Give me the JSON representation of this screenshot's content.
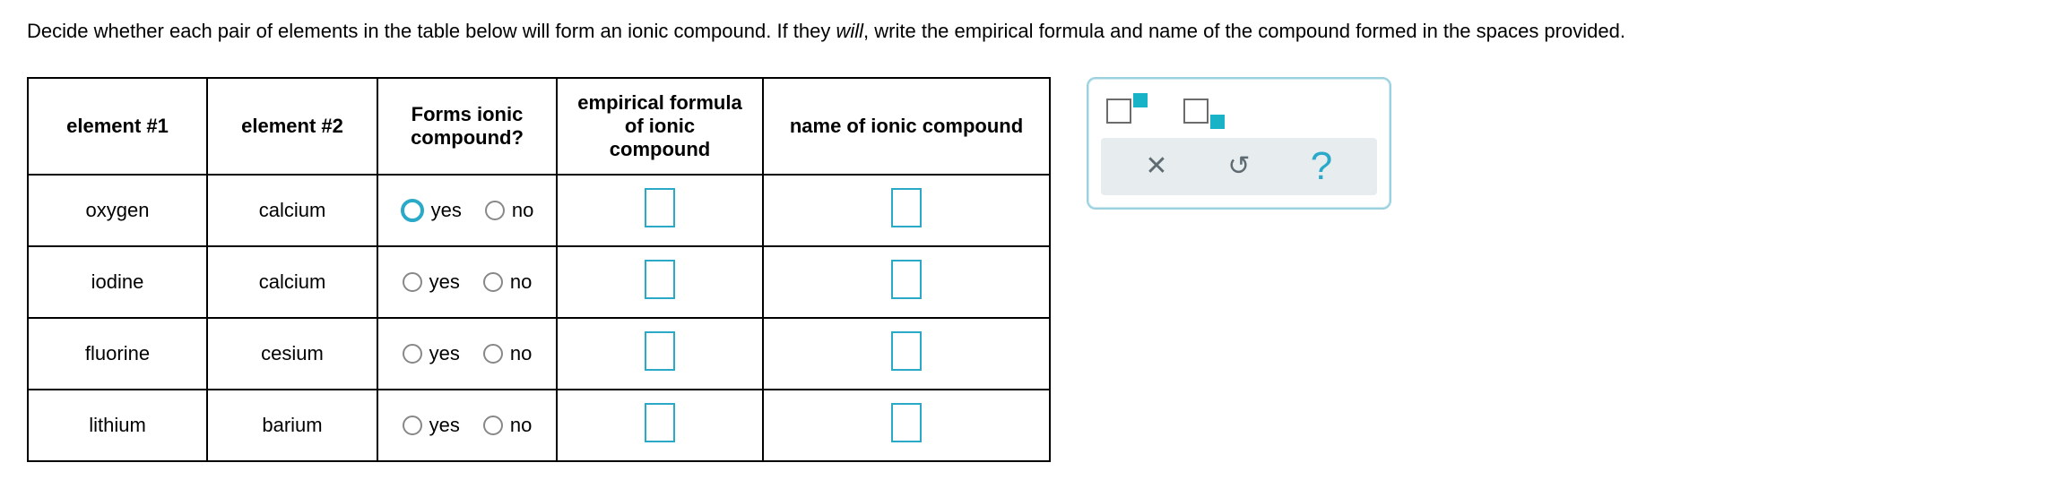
{
  "instructions": {
    "pre": "Decide whether each pair of elements in the table below will form an ionic compound. If they ",
    "em": "will",
    "post": ", write the empirical formula and name of the compound formed in the spaces provided."
  },
  "headers": {
    "element1": "element #1",
    "element2": "element #2",
    "forms": "Forms ionic compound?",
    "formula": "empirical formula of ionic compound",
    "name": "name of ionic compound"
  },
  "radio_labels": {
    "yes": "yes",
    "no": "no"
  },
  "rows": [
    {
      "e1": "oxygen",
      "e2": "calcium",
      "yes_focus": true
    },
    {
      "e1": "iodine",
      "e2": "calcium",
      "yes_focus": false
    },
    {
      "e1": "fluorine",
      "e2": "cesium",
      "yes_focus": false
    },
    {
      "e1": "lithium",
      "e2": "barium",
      "yes_focus": false
    }
  ],
  "toolbox": {
    "superscript": "superscript",
    "subscript": "subscript",
    "close": "✕",
    "reset": "↺",
    "help": "?"
  }
}
